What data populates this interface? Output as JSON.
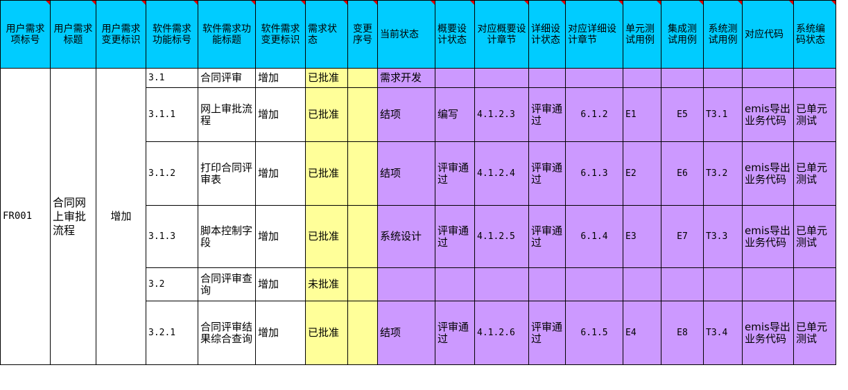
{
  "headers": {
    "req_id": "用户需求项标号",
    "req_title": "用户需求标题",
    "req_change": "用户需求变更标识",
    "func_id": "软件需求功能标号",
    "func_title": "软件需求功能标题",
    "func_change": "软件需求变更标识",
    "req_status": "需求状态",
    "change_seq": "变更序号",
    "current_status": "当前状态",
    "outline_status": "概要设计状态",
    "outline_section": "对应概要设计章节",
    "detail_status": "详细设计状态",
    "detail_section": "对应详细设计章节",
    "unit_test": "单元测试用例",
    "integration_test": "集成测试用例",
    "system_test": "系统测试用例",
    "code": "对应代码",
    "system_code_status": "系统编码状态"
  },
  "group": {
    "req_id": "FR001",
    "req_title": "合同网上审批流程",
    "req_change": "增加"
  },
  "rows": [
    {
      "func_id": "3.1",
      "func_title": "合同评审",
      "func_change": "增加",
      "req_status": "已批准",
      "change_seq": "",
      "current_status": "需求开发",
      "outline_status": "",
      "outline_section": "",
      "detail_status": "",
      "detail_section": "",
      "unit_test": "",
      "integration_test": "",
      "system_test": "",
      "code": "",
      "system_code_status": ""
    },
    {
      "func_id": "3.1.1",
      "func_title": "网上审批流程",
      "func_change": "增加",
      "req_status": "已批准",
      "change_seq": "",
      "current_status": "结项",
      "outline_status": "编写",
      "outline_section": "4.1.2.3",
      "detail_status": "评审通过",
      "detail_section": "6.1.2",
      "unit_test": "E1",
      "integration_test": "E5",
      "system_test": "T3.1",
      "code": "emis导出业务代码",
      "system_code_status": "已单元测试"
    },
    {
      "func_id": "3.1.2",
      "func_title": "打印合同评审表",
      "func_change": "增加",
      "req_status": "已批准",
      "change_seq": "",
      "current_status": "结项",
      "outline_status": "评审通过",
      "outline_section": "4.1.2.4",
      "detail_status": "评审通过",
      "detail_section": "6.1.3",
      "unit_test": "E2",
      "integration_test": "E6",
      "system_test": "T3.2",
      "code": "emis导出业务代码",
      "system_code_status": "已单元测试"
    },
    {
      "func_id": "3.1.3",
      "func_title": "脚本控制字段",
      "func_change": "增加",
      "req_status": "已批准",
      "change_seq": "",
      "current_status": "系统设计",
      "outline_status": "评审通过",
      "outline_section": "4.1.2.5",
      "detail_status": "评审通过",
      "detail_section": "6.1.4",
      "unit_test": "E3",
      "integration_test": "E7",
      "system_test": "T3.3",
      "code": "emis导出业务代码",
      "system_code_status": "已单元测试"
    },
    {
      "func_id": "3.2",
      "func_title": "合同评审查询",
      "func_change": "增加",
      "req_status": "未批准",
      "change_seq": "",
      "current_status": "",
      "outline_status": "",
      "outline_section": "",
      "detail_status": "",
      "detail_section": "",
      "unit_test": "",
      "integration_test": "",
      "system_test": "",
      "code": "",
      "system_code_status": ""
    },
    {
      "func_id": "3.2.1",
      "func_title": "合同评审结果综合查询",
      "func_change": "增加",
      "req_status": "已批准",
      "change_seq": "",
      "current_status": "结项",
      "outline_status": "评审通过",
      "outline_section": "4.1.2.6",
      "detail_status": "评审通过",
      "detail_section": "6.1.5",
      "unit_test": "E4",
      "integration_test": "E8",
      "system_test": "T3.4",
      "code": "emis导出业务代码",
      "system_code_status": "已单元测试"
    }
  ],
  "colors": {
    "header": "#00ccff",
    "approved_status": "#ffff99",
    "tracking": "#cc99ff",
    "comment_marker": "#e00000"
  }
}
